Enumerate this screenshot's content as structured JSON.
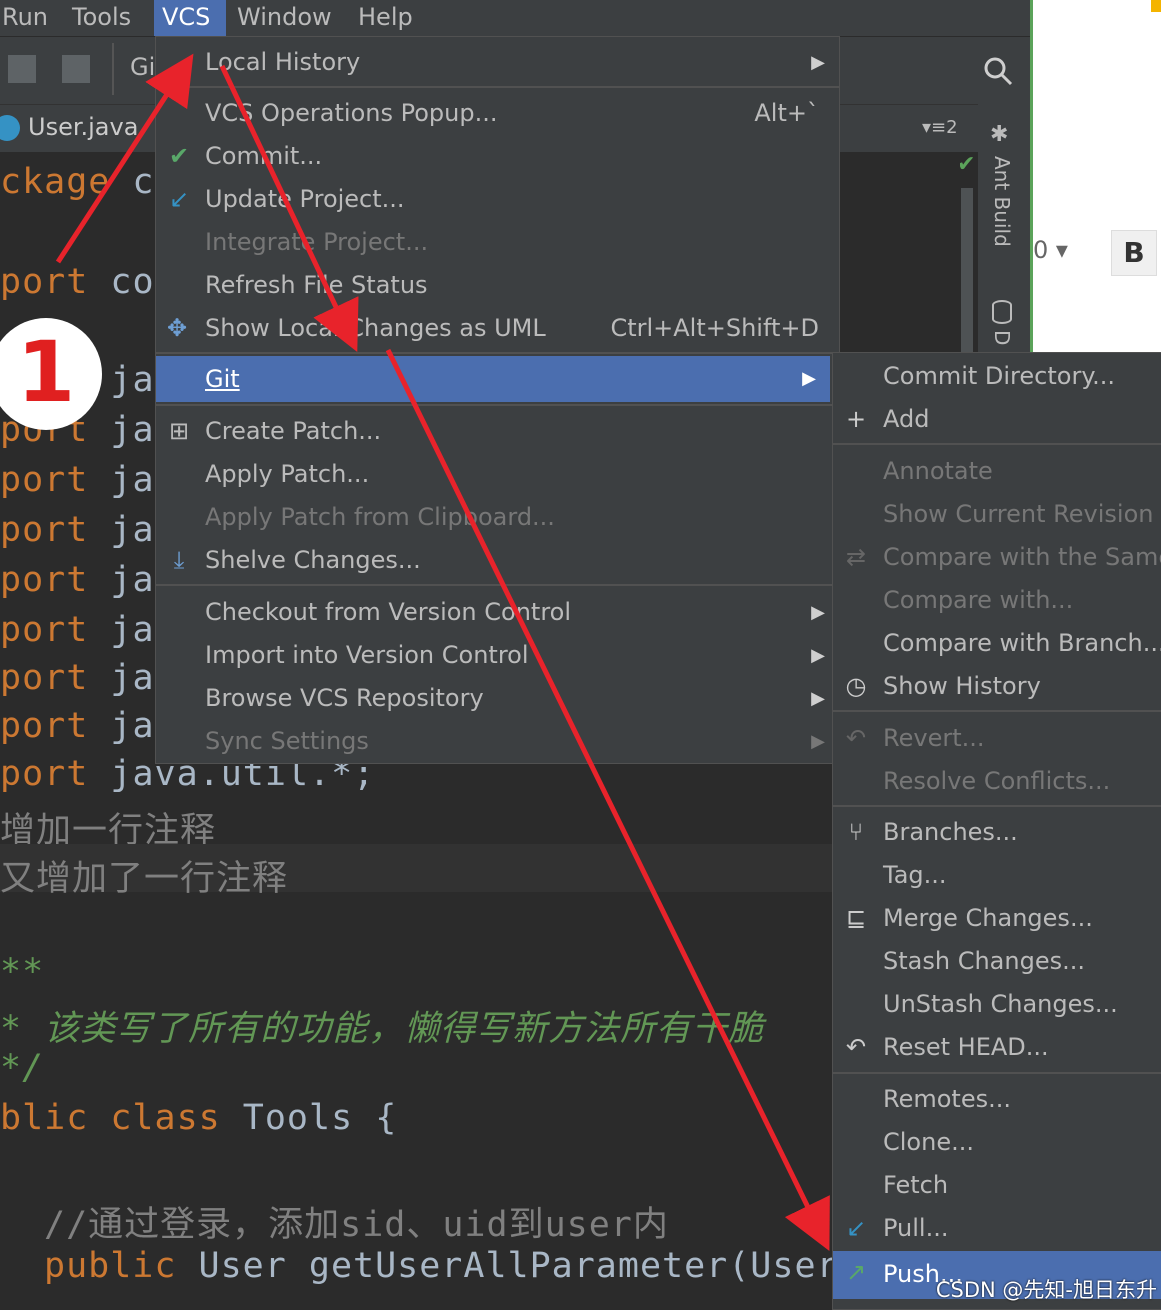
{
  "menubar": {
    "items": [
      "Run",
      "Tools",
      "VCS",
      "Window",
      "Help"
    ]
  },
  "toolbar": {
    "git_label": "Gi"
  },
  "tab": {
    "file_name": "User.java",
    "editor_count": "2"
  },
  "side_panel": {
    "ant_build": "Ant Build",
    "db_label": "D"
  },
  "right_panel": {
    "dropdown_frag": "0 ▾",
    "bold_button": "B"
  },
  "editor": {
    "lines": [
      {
        "kw": "ckage",
        "rest": " co"
      },
      {
        "kw": "port",
        "rest": " co"
      },
      {
        "kw": "port",
        "rest": " ja"
      },
      {
        "kw": "port",
        "rest": " ja"
      },
      {
        "kw": "port",
        "rest": " ja"
      },
      {
        "kw": "port",
        "rest": " ja"
      },
      {
        "kw": "port",
        "rest": " ja"
      },
      {
        "kw": "port",
        "rest": " ja"
      },
      {
        "kw": "port",
        "rest": " ja"
      },
      {
        "kw": "port",
        "rest": " ja"
      },
      {
        "kw": "port",
        "rest": " java.util.*;"
      }
    ],
    "comment1": "增加一行注释",
    "comment2": "又增加了一行注释",
    "doc1": "**",
    "doc2": "* 该类写了所有的功能，懒得写新方法所有干脆",
    "doc3": "*/",
    "class_kw": "blic class",
    "class_name": " Tools {",
    "comment3": "//通过登录，添加sid、uid到user内",
    "method_kw": "public",
    "method_rest": " User getUserAllParameter(User u"
  },
  "vcs_menu": {
    "items": [
      {
        "label": "Local History",
        "submenu": true
      },
      {
        "label": "VCS Operations Popup...",
        "shortcut": "Alt+`"
      },
      {
        "label": "Commit...",
        "icon": "check-icon"
      },
      {
        "label": "Update Project...",
        "icon": "update-arrow-icon"
      },
      {
        "label": "Integrate Project...",
        "disabled": true
      },
      {
        "label": "Refresh File Status"
      },
      {
        "label": "Show Local Changes as UML",
        "shortcut": "Ctrl+Alt+Shift+D",
        "icon": "uml-icon"
      },
      {
        "label": "Git",
        "submenu": true,
        "selected": true
      },
      {
        "label": "Create Patch...",
        "icon": "patch-icon"
      },
      {
        "label": "Apply Patch..."
      },
      {
        "label": "Apply Patch from Clipboard...",
        "disabled": true
      },
      {
        "label": "Shelve Changes...",
        "icon": "shelve-icon"
      },
      {
        "label": "Checkout from Version Control",
        "submenu": true
      },
      {
        "label": "Import into Version Control",
        "submenu": true
      },
      {
        "label": "Browse VCS Repository",
        "submenu": true
      },
      {
        "label": "Sync Settings",
        "submenu": true,
        "disabled": true
      }
    ]
  },
  "git_menu": {
    "items": [
      {
        "label": "Commit Directory..."
      },
      {
        "label": "Add",
        "icon": "plus-icon"
      },
      {
        "label": "Annotate",
        "disabled": true
      },
      {
        "label": "Show Current Revision",
        "disabled": true
      },
      {
        "label": "Compare with the Same",
        "disabled": true,
        "icon": "compare-icon"
      },
      {
        "label": "Compare with...",
        "disabled": true
      },
      {
        "label": "Compare with Branch..."
      },
      {
        "label": "Show History",
        "icon": "clock-icon"
      },
      {
        "label": "Revert...",
        "disabled": true,
        "icon": "revert-icon"
      },
      {
        "label": "Resolve Conflicts...",
        "disabled": true
      },
      {
        "label": "Branches...",
        "icon": "branch-icon"
      },
      {
        "label": "Tag..."
      },
      {
        "label": "Merge Changes...",
        "icon": "merge-icon"
      },
      {
        "label": "Stash Changes..."
      },
      {
        "label": "UnStash Changes..."
      },
      {
        "label": "Reset HEAD...",
        "icon": "reset-icon"
      },
      {
        "label": "Remotes..."
      },
      {
        "label": "Clone..."
      },
      {
        "label": "Fetch"
      },
      {
        "label": "Pull...",
        "icon": "pull-icon"
      },
      {
        "label": "Push...",
        "icon": "push-icon",
        "selected": true
      }
    ]
  },
  "annotation": {
    "step_number": "1"
  },
  "watermark": "CSDN @先知-旭日东升",
  "colors": {
    "menu_bg": "#3c3f41",
    "selection": "#4b6eaf",
    "arrow": "#e8232b"
  }
}
